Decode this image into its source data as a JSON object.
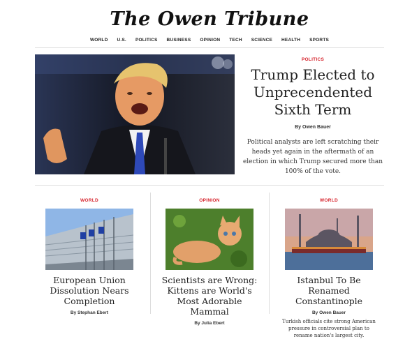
{
  "masthead": {
    "title": "The Owen Tribune"
  },
  "nav": [
    "WORLD",
    "U.S.",
    "POLITICS",
    "BUSINESS",
    "OPINION",
    "TECH",
    "SCIENCE",
    "HEALTH",
    "SPORTS"
  ],
  "hero": {
    "category": "POLITICS",
    "title": "Trump Elected to Unprecendented Sixth Term",
    "byline": "By Owen Bauer",
    "body": "Political analysts are left scratching their heads yet again in the aftermath of an election in which Trump secured more than 100% of the vote."
  },
  "cards": [
    {
      "category": "WORLD",
      "title": "European Union Dissolution Nears Completion",
      "byline": "By Stephan Ebert",
      "body": ""
    },
    {
      "category": "OPINION",
      "title": "Scientists are Wrong: Kittens are World's Most Adorable Mammal",
      "byline": "By Julia Ebert",
      "body": ""
    },
    {
      "category": "WORLD",
      "title": "Istanbul To Be Renamed Constantinople",
      "byline": "By Owen Bauer",
      "body": "Turkish officials cite strong American pressure in controversial plan to rename nation's largest city."
    }
  ],
  "colors": {
    "accent": "#d6242d",
    "divider": "#dddddd"
  }
}
